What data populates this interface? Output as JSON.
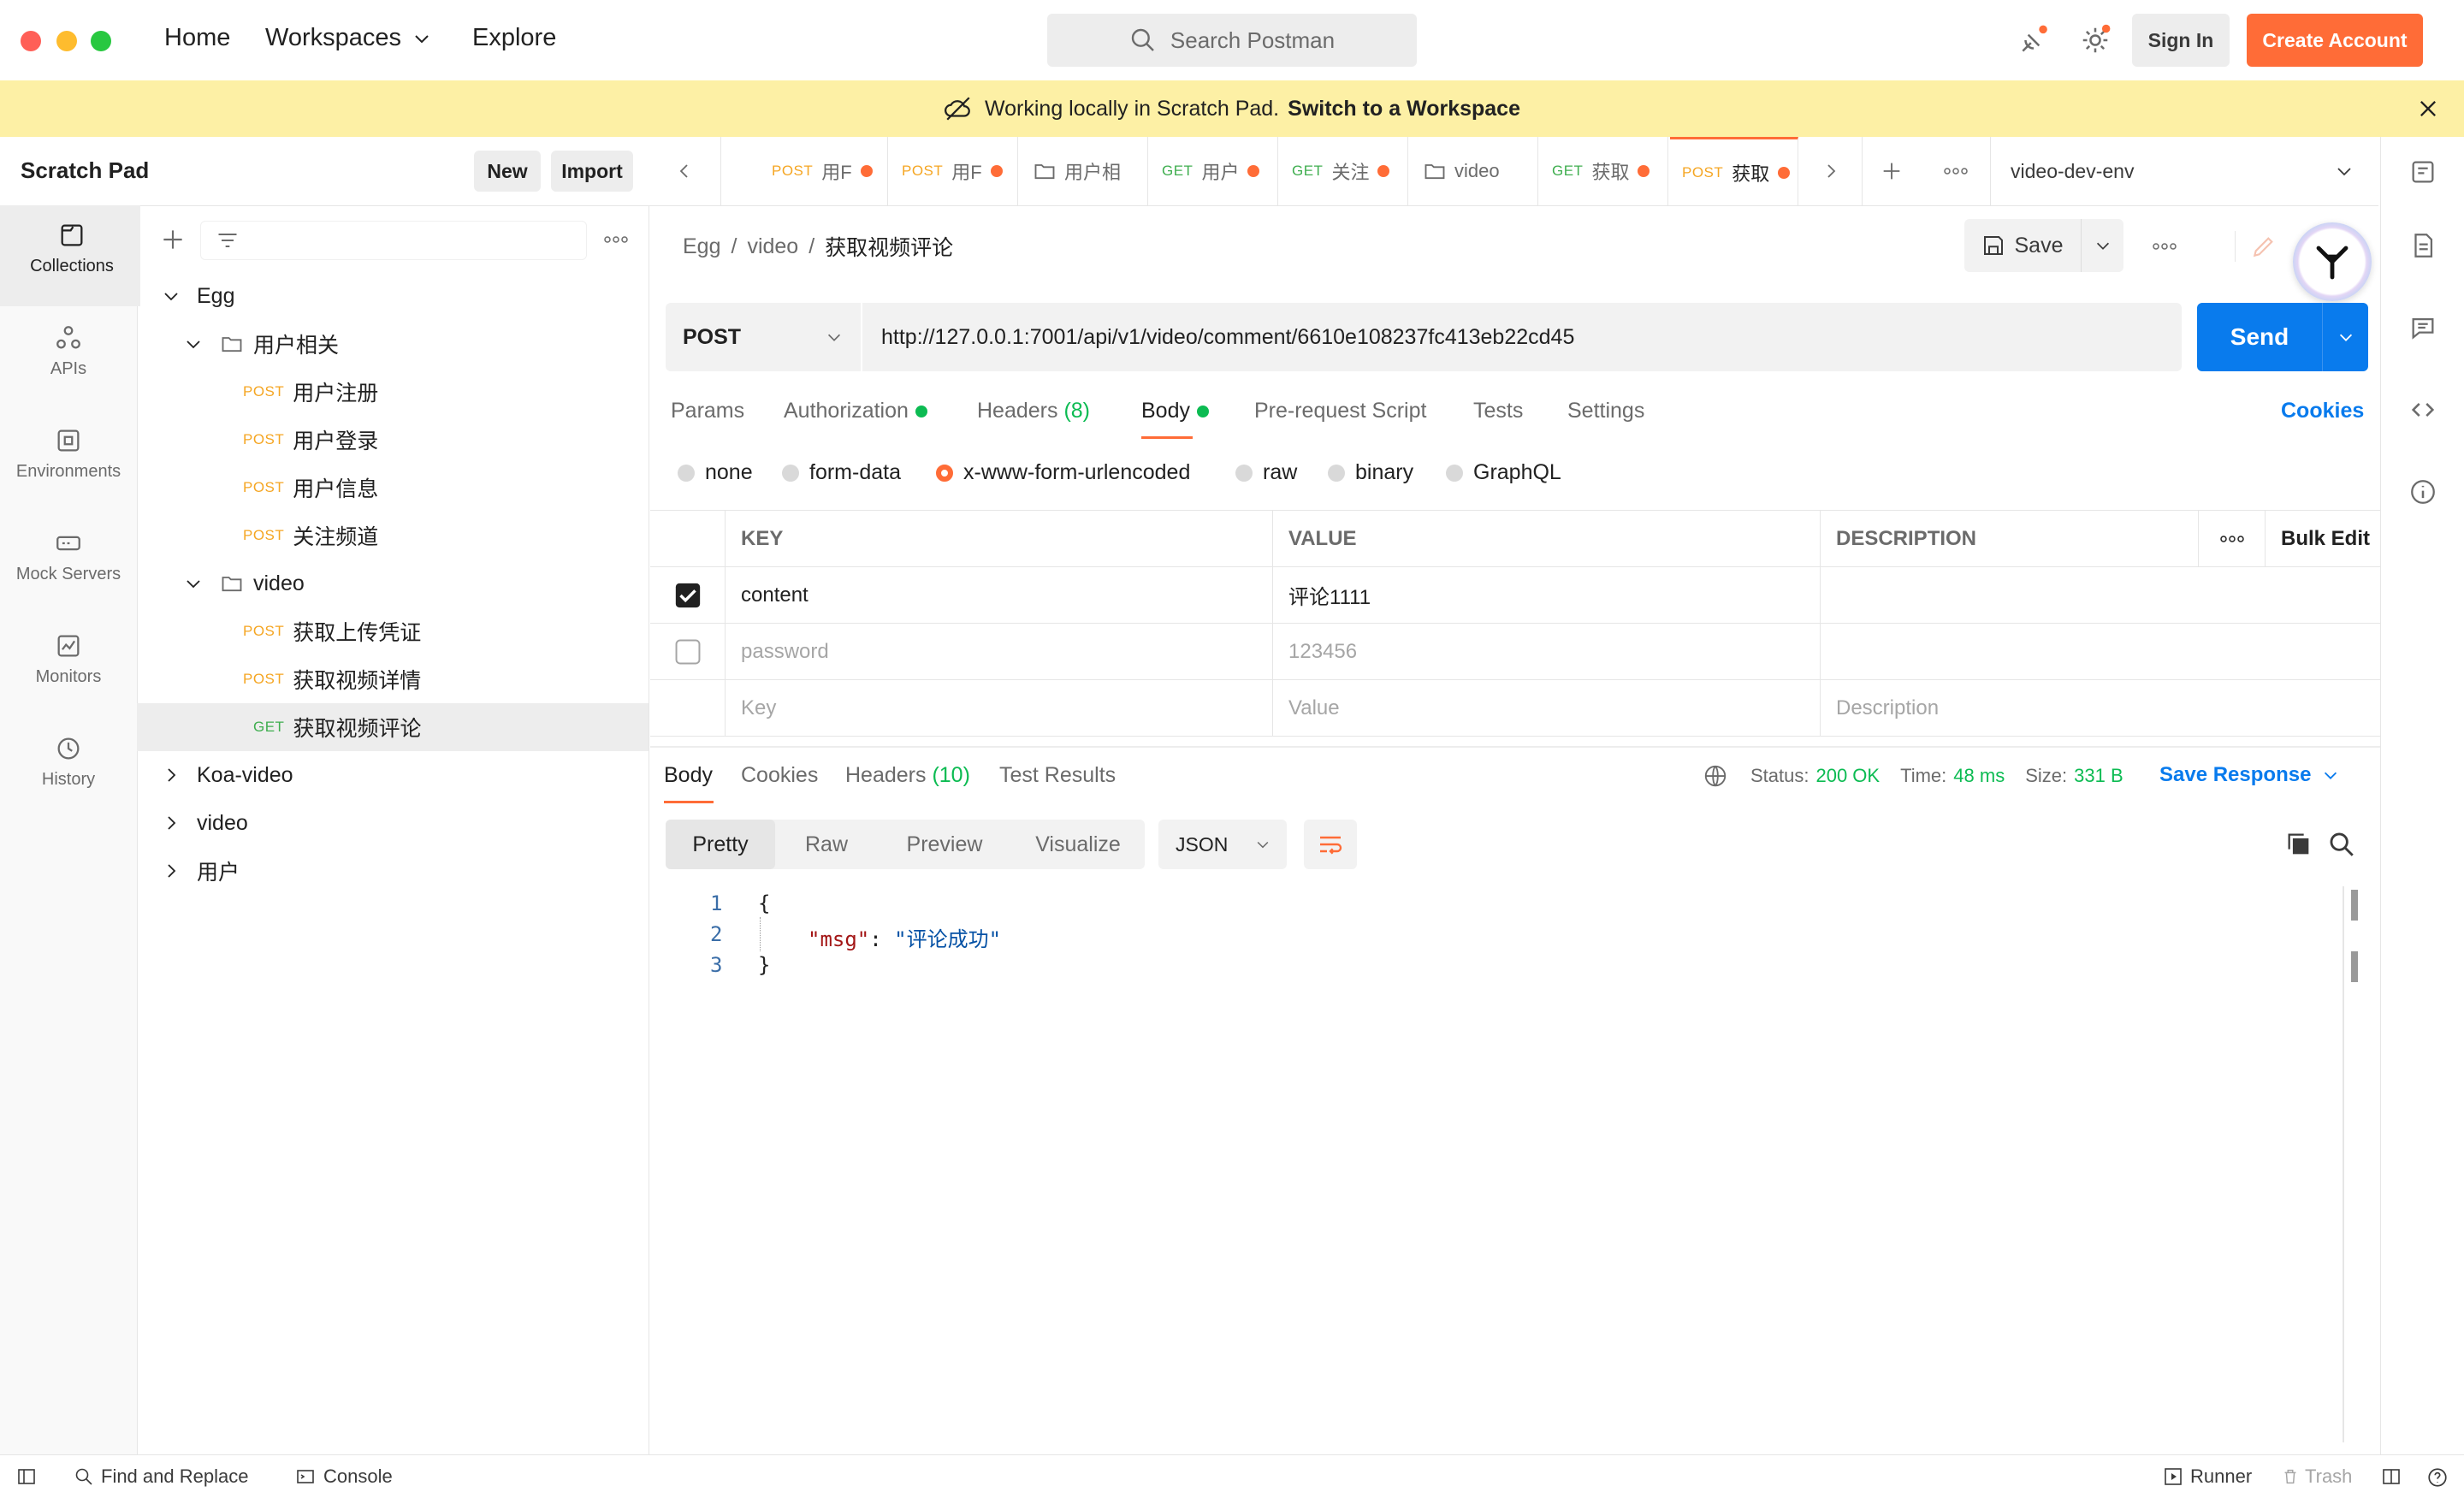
{
  "titlebar": {
    "nav": {
      "home": "Home",
      "workspaces": "Workspaces",
      "explore": "Explore"
    },
    "search_placeholder": "Search Postman",
    "sign_in": "Sign In",
    "create_account": "Create Account"
  },
  "banner": {
    "text": "Working locally in Scratch Pad.",
    "link": "Switch to a Workspace"
  },
  "scratchpad": {
    "title": "Scratch Pad",
    "new": "New",
    "import": "Import"
  },
  "rail": {
    "collections": "Collections",
    "apis": "APIs",
    "environments": "Environments",
    "mock_servers": "Mock Servers",
    "monitors": "Monitors",
    "history": "History"
  },
  "tree": {
    "egg": "Egg",
    "folder1": "用户相关",
    "f1_items": [
      {
        "method": "POST",
        "name": "用户注册"
      },
      {
        "method": "POST",
        "name": "用户登录"
      },
      {
        "method": "POST",
        "name": "用户信息"
      },
      {
        "method": "POST",
        "name": "关注频道"
      }
    ],
    "folder2": "video",
    "f2_items": [
      {
        "method": "POST",
        "name": "获取上传凭证"
      },
      {
        "method": "POST",
        "name": "获取视频详情"
      },
      {
        "method": "GET",
        "name": "获取视频评论"
      }
    ],
    "others": [
      "Koa-video",
      "video",
      "用户"
    ]
  },
  "tabs": [
    {
      "method": "POST",
      "name": "用F"
    },
    {
      "method": "POST",
      "name": "用F"
    },
    {
      "method": "",
      "name": "用户相"
    },
    {
      "method": "GET",
      "name": "用户"
    },
    {
      "method": "GET",
      "name": "关注"
    },
    {
      "method": "",
      "name": "video"
    },
    {
      "method": "GET",
      "name": "获取"
    },
    {
      "method": "POST",
      "name": "获取"
    }
  ],
  "environment": "video-dev-env",
  "request": {
    "breadcrumb": [
      "Egg",
      "video",
      "获取视频评论"
    ],
    "save": "Save",
    "method": "POST",
    "url": "http://127.0.0.1:7001/api/v1/video/comment/6610e108237fc413eb22cd45",
    "send": "Send",
    "tabs": {
      "params": "Params",
      "authorization": "Authorization",
      "headers": "Headers",
      "headers_count": "(8)",
      "body": "Body",
      "prerequest": "Pre-request Script",
      "tests": "Tests",
      "settings": "Settings"
    },
    "cookies": "Cookies",
    "body_types": [
      "none",
      "form-data",
      "x-www-form-urlencoded",
      "raw",
      "binary",
      "GraphQL"
    ],
    "table": {
      "headers": {
        "key": "KEY",
        "value": "VALUE",
        "description": "DESCRIPTION",
        "bulk_edit": "Bulk Edit"
      },
      "rows": [
        {
          "key": "content",
          "value": "评论1111",
          "checked": true
        },
        {
          "key": "password",
          "value": "123456",
          "checked": false
        }
      ],
      "placeholders": {
        "key": "Key",
        "value": "Value",
        "description": "Description"
      }
    }
  },
  "response": {
    "tabs": {
      "body": "Body",
      "cookies": "Cookies",
      "headers": "Headers",
      "headers_count": "(10)",
      "test_results": "Test Results"
    },
    "status_label": "Status:",
    "status": "200 OK",
    "time_label": "Time:",
    "time": "48 ms",
    "size_label": "Size:",
    "size": "331 B",
    "save_response": "Save Response",
    "views": [
      "Pretty",
      "Raw",
      "Preview",
      "Visualize"
    ],
    "format": "JSON",
    "code": {
      "line_numbers": [
        "1",
        "2",
        "3"
      ],
      "open": "{",
      "key": "\"msg\"",
      "colon": ":",
      "value": "\"评论成功\"",
      "close": "}"
    }
  },
  "statusbar": {
    "find_replace": "Find and Replace",
    "console": "Console",
    "runner": "Runner",
    "trash": "Trash"
  },
  "colors": {
    "accent": "#ff6c37",
    "send": "#097bed",
    "banner": "#fdf0a5",
    "status_green": "#0cbb52"
  }
}
